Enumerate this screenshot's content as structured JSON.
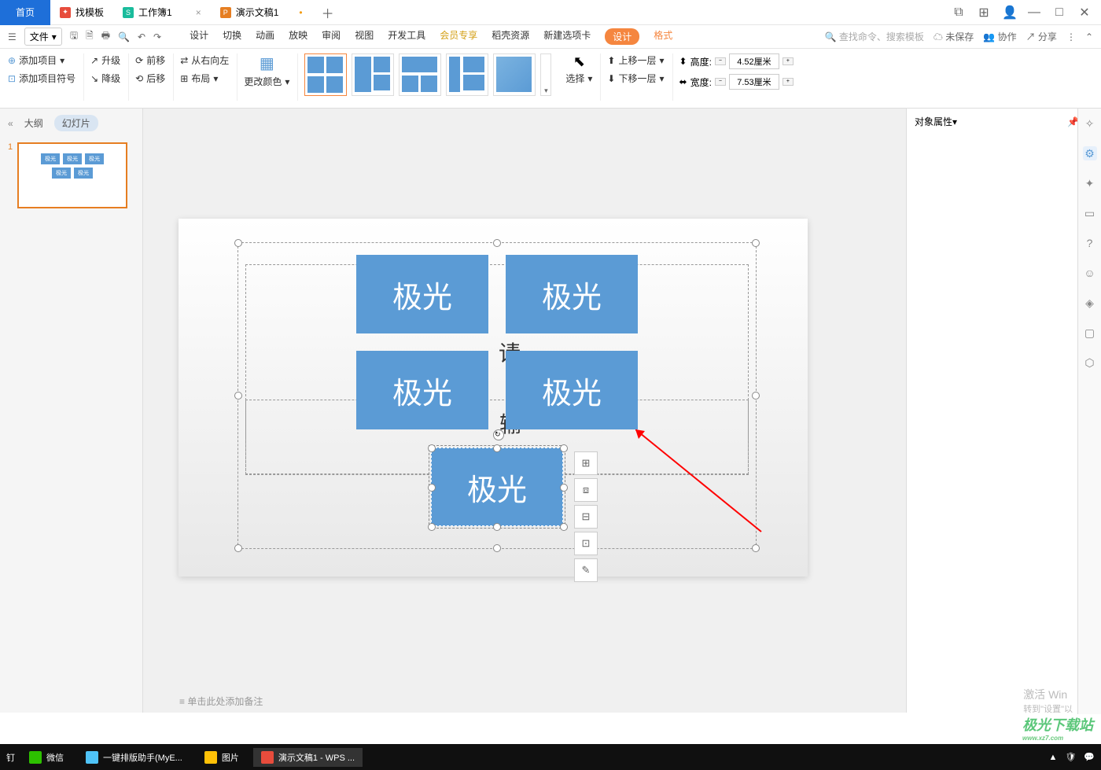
{
  "titlebar": {
    "home": "首页",
    "tabs": [
      {
        "icon": "template",
        "label": "找模板"
      },
      {
        "icon": "sheet",
        "label": "工作簿1"
      },
      {
        "icon": "ppt",
        "label": "演示文稿1",
        "modified": true
      }
    ]
  },
  "menubar": {
    "file": "文件",
    "tabs": [
      "设计",
      "切换",
      "动画",
      "放映",
      "审阅",
      "视图",
      "开发工具",
      "会员专享",
      "稻壳资源",
      "新建选项卡"
    ],
    "design": "设计",
    "format": "格式",
    "search_cmd": "查找命令、搜索模板",
    "unsaved": "未保存",
    "collab": "协作",
    "share": "分享"
  },
  "ribbon": {
    "add_item": "添加项目",
    "add_symbol": "添加项目符号",
    "upgrade": "升级",
    "downgrade": "降级",
    "forward": "前移",
    "backward": "后移",
    "right_to_left": "从右向左",
    "layout": "布局",
    "change_color": "更改颜色",
    "select": "选择",
    "move_up": "上移一层",
    "move_down": "下移一层",
    "height_label": "高度:",
    "width_label": "宽度:",
    "height_value": "4.52厘米",
    "width_value": "7.53厘米"
  },
  "outline": {
    "outline_tab": "大纲",
    "slide_tab": "幻灯片",
    "slide_num": "1",
    "thumb_text": "极光"
  },
  "canvas": {
    "shape_text": "极光",
    "bg_hint1": "请",
    "bg_hint2": "输",
    "footer": "单击此处添加备注"
  },
  "right_panel": {
    "title": "对象属性"
  },
  "watermark": {
    "line1": "激活 Win",
    "line2": "转到\"设置\"以",
    "logo": "极光下载站",
    "logo_url": "www.xz7.com"
  },
  "taskbar": {
    "pin": "钉",
    "items": [
      {
        "label": "微信",
        "color": "#2dc100"
      },
      {
        "label": "一键排版助手(MyE...",
        "color": "#4fc3f7"
      },
      {
        "label": "图片",
        "color": "#ffc107"
      },
      {
        "label": "演示文稿1 - WPS ...",
        "color": "#e74c3c",
        "active": true
      }
    ]
  }
}
